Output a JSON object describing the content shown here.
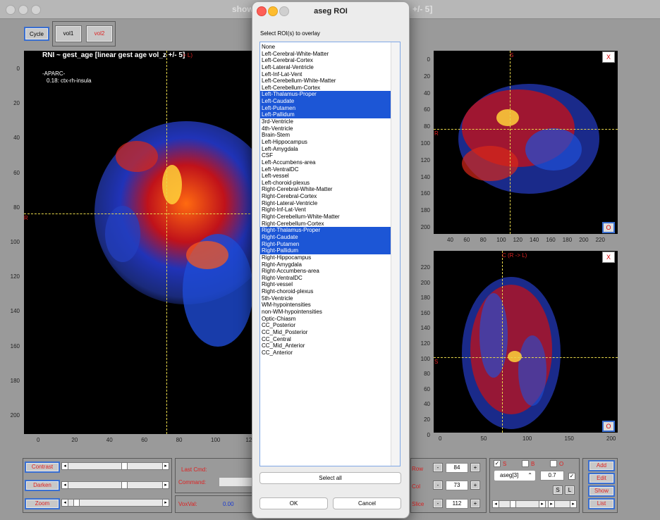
{
  "window": {
    "title": "show",
    "title_right": "+/- 5]"
  },
  "toolbar": {
    "cycle": "Cycle",
    "vol1": "vol1",
    "vol2": "vol2"
  },
  "main_view": {
    "title": "RNI ~ gest_age [linear gest age vol_z +/- 5]",
    "title_suffix": "> L)",
    "aparc_label": "-APARC-",
    "aparc_value": "0.18: ctx-rh-insula",
    "left_marker": "R",
    "y_ticks": [
      "0",
      "20",
      "40",
      "60",
      "80",
      "100",
      "120",
      "140",
      "160",
      "180",
      "200"
    ],
    "x_ticks": [
      "0",
      "20",
      "40",
      "60",
      "80",
      "100",
      "12"
    ]
  },
  "sagittal_view": {
    "top_marker": "S",
    "left_marker": "R",
    "y_ticks": [
      "0",
      "20",
      "40",
      "60",
      "80",
      "100",
      "120",
      "140",
      "160",
      "180",
      "200"
    ],
    "x_ticks": [
      "40",
      "60",
      "80",
      "100",
      "120",
      "140",
      "160",
      "180",
      "200",
      "220"
    ],
    "close": "X",
    "option": "O"
  },
  "axial_view": {
    "top_marker": "C (R -> L)",
    "left_marker": "S",
    "y_ticks": [
      "220",
      "200",
      "180",
      "160",
      "140",
      "120",
      "100",
      "80",
      "60",
      "40",
      "20",
      "0"
    ],
    "x_ticks": [
      "0",
      "50",
      "100",
      "150",
      "200"
    ],
    "close": "X",
    "option": "O"
  },
  "controls": {
    "contrast": "Contrast",
    "darken": "Darken",
    "zoom": "Zoom",
    "contrast_level": 0.6,
    "darken_level": 0.6,
    "zoom_level": 0.05,
    "last_cmd_label": "Last Cmd:",
    "command_label": "Command:",
    "voxval_label": "VoxVal:",
    "voxval": "0.00",
    "row_label": "Row",
    "row_value": "84",
    "col_label": "Col",
    "col_value": "73",
    "slice_label": "Slice",
    "slice_value": "112",
    "minus": "-",
    "plus": "+",
    "chk_s": "S",
    "chk_b": "B",
    "chk_o": "O",
    "aseg_select": "aseg[3]",
    "alpha_value": "0.7",
    "btn_s": "S",
    "btn_l": "L",
    "add": "Add",
    "edit": "Edit",
    "show": "Show",
    "list": "List"
  },
  "dialog": {
    "title": "aseg ROI",
    "prompt": "Select ROI(s) to overlay",
    "items": [
      {
        "label": "None",
        "selected": false
      },
      {
        "label": "Left-Cerebral-White-Matter",
        "selected": false
      },
      {
        "label": "Left-Cerebral-Cortex",
        "selected": false
      },
      {
        "label": "Left-Lateral-Ventricle",
        "selected": false
      },
      {
        "label": "Left-Inf-Lat-Vent",
        "selected": false
      },
      {
        "label": "Left-Cerebellum-White-Matter",
        "selected": false
      },
      {
        "label": "Left-Cerebellum-Cortex",
        "selected": false
      },
      {
        "label": "Left-Thalamus-Proper",
        "selected": true
      },
      {
        "label": "Left-Caudate",
        "selected": true
      },
      {
        "label": "Left-Putamen",
        "selected": true
      },
      {
        "label": "Left-Pallidum",
        "selected": true
      },
      {
        "label": "3rd-Ventricle",
        "selected": false
      },
      {
        "label": "4th-Ventricle",
        "selected": false
      },
      {
        "label": "Brain-Stem",
        "selected": false
      },
      {
        "label": "Left-Hippocampus",
        "selected": false
      },
      {
        "label": "Left-Amygdala",
        "selected": false
      },
      {
        "label": "CSF",
        "selected": false
      },
      {
        "label": "Left-Accumbens-area",
        "selected": false
      },
      {
        "label": "Left-VentralDC",
        "selected": false
      },
      {
        "label": "Left-vessel",
        "selected": false
      },
      {
        "label": "Left-choroid-plexus",
        "selected": false
      },
      {
        "label": "Right-Cerebral-White-Matter",
        "selected": false
      },
      {
        "label": "Right-Cerebral-Cortex",
        "selected": false
      },
      {
        "label": "Right-Lateral-Ventricle",
        "selected": false
      },
      {
        "label": "Right-Inf-Lat-Vent",
        "selected": false
      },
      {
        "label": "Right-Cerebellum-White-Matter",
        "selected": false
      },
      {
        "label": "Right-Cerebellum-Cortex",
        "selected": false
      },
      {
        "label": "Right-Thalamus-Proper",
        "selected": true
      },
      {
        "label": "Right-Caudate",
        "selected": true
      },
      {
        "label": "Right-Putamen",
        "selected": true
      },
      {
        "label": "Right-Pallidum",
        "selected": true
      },
      {
        "label": "Right-Hippocampus",
        "selected": false
      },
      {
        "label": "Right-Amygdala",
        "selected": false
      },
      {
        "label": "Right-Accumbens-area",
        "selected": false
      },
      {
        "label": "Right-VentralDC",
        "selected": false
      },
      {
        "label": "Right-vessel",
        "selected": false
      },
      {
        "label": "Right-choroid-plexus",
        "selected": false
      },
      {
        "label": "5th-Ventricle",
        "selected": false
      },
      {
        "label": "WM-hypointensities",
        "selected": false
      },
      {
        "label": "non-WM-hypointensities",
        "selected": false
      },
      {
        "label": "Optic-Chiasm",
        "selected": false
      },
      {
        "label": "CC_Posterior",
        "selected": false
      },
      {
        "label": "CC_Mid_Posterior",
        "selected": false
      },
      {
        "label": "CC_Central",
        "selected": false
      },
      {
        "label": "CC_Mid_Anterior",
        "selected": false
      },
      {
        "label": "CC_Anterior",
        "selected": false
      }
    ],
    "select_all": "Select all",
    "ok": "OK",
    "cancel": "Cancel"
  },
  "colors": {
    "selection": "#1c56d6",
    "crosshair": "#e8d84a",
    "label_red": "#dd2222"
  }
}
